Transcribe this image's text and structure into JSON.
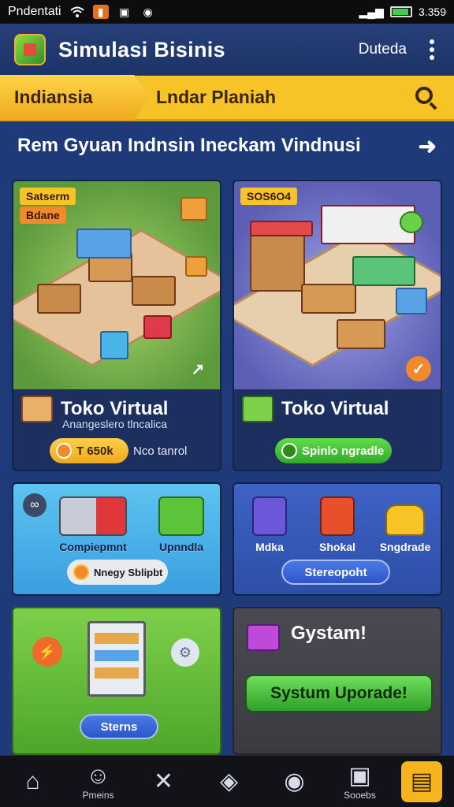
{
  "status_bar": {
    "carrier": "Pndentati",
    "time": "3.359",
    "battery_level": 0.85,
    "icons": [
      "wifi-icon",
      "notification-icon",
      "gallery-icon",
      "game-icon"
    ]
  },
  "app_bar": {
    "title": "Simulasi Bisinis",
    "user": "Duteda"
  },
  "tabs": [
    {
      "label": "Indiansia",
      "active": true
    },
    {
      "label": "Lndar Planiah",
      "active": false
    }
  ],
  "banner": {
    "text": "Rem Gyuan Indnsin Ineckam Vindnusi",
    "arrow": "➜"
  },
  "shop_cards": [
    {
      "tag_top": "Satserm",
      "tag_bottom": "Bdane",
      "title": "Toko Virtual",
      "subtitle": "Anangeslero tlncalica",
      "pill_label": "T 650k",
      "extra_text": "Nco tanrol"
    },
    {
      "tag_top": "SOS6O4",
      "title": "Toko Virtual",
      "pill_label": "Spinlo ngradle"
    }
  ],
  "mid_cards": [
    {
      "items": [
        {
          "label": "Compiepmnt",
          "icon": "shopping-cart-icon"
        },
        {
          "label": "Upnndla",
          "icon": "gift-box-icon"
        }
      ],
      "button_label": "Nnegy Sblipbt"
    },
    {
      "items": [
        {
          "label": "Mdka",
          "icon": "purple-box-icon"
        },
        {
          "label": "Shokal",
          "icon": "red-crate-icon"
        },
        {
          "label": "Sngdrade",
          "icon": "car-icon"
        }
      ],
      "button_label": "Stereopoht"
    }
  ],
  "bottom_cards": [
    {
      "button_label": "Sterns"
    },
    {
      "title": "Gystam!",
      "button_label": "Systum Uporade!"
    }
  ],
  "nav": [
    {
      "label": "",
      "icon": "home-icon",
      "glyph": "⌂"
    },
    {
      "label": "Pmeins",
      "icon": "people-icon",
      "glyph": "☺"
    },
    {
      "label": "",
      "icon": "tools-icon",
      "glyph": "✕"
    },
    {
      "label": "",
      "icon": "ticket-icon",
      "glyph": "◈"
    },
    {
      "label": "",
      "icon": "compass-icon",
      "glyph": "◉"
    },
    {
      "label": "Sooebs",
      "icon": "tablet-icon",
      "glyph": "▣"
    },
    {
      "label": "",
      "icon": "folder-icon",
      "glyph": "▤",
      "active": true
    }
  ],
  "colors": {
    "accent_yellow": "#f6c426",
    "navy": "#1f3a78",
    "green": "#3fbf3a"
  }
}
